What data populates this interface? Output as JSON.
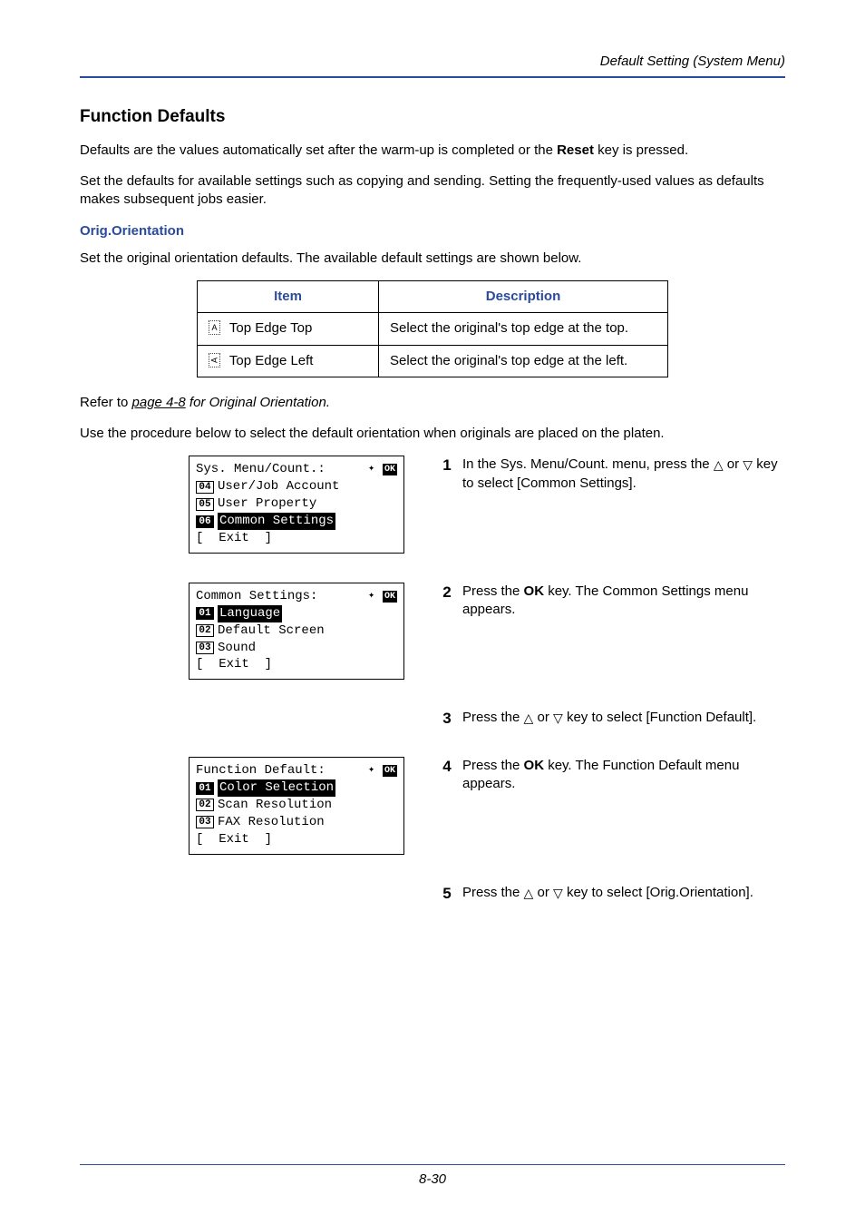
{
  "running_head": "Default Setting (System Menu)",
  "section": {
    "title": "Function Defaults",
    "intro1_a": "Defaults are the values automatically set after the warm-up is completed or the ",
    "intro1_bold": "Reset",
    "intro1_b": " key is pressed.",
    "intro2": "Set the defaults for available settings such as copying and sending. Setting the frequently-used values as defaults makes subsequent jobs easier."
  },
  "orig": {
    "heading": "Orig.Orientation",
    "para": "Set the original orientation defaults. The available default settings are shown below."
  },
  "table": {
    "headers": {
      "item": "Item",
      "desc": "Description"
    },
    "rows": [
      {
        "item": "Top Edge Top",
        "desc": "Select the original's top edge at the top."
      },
      {
        "item": "Top Edge Left",
        "desc": "Select the original's top edge at the left."
      }
    ]
  },
  "refer": {
    "a": "Refer to ",
    "link": "page 4-8",
    "b": " for Original Orientation."
  },
  "procedure_intro": "Use the procedure below to select the default orientation when originals are placed on the platen.",
  "lcd": {
    "screen1": {
      "title_a": "Sys. Menu/Count.",
      "title_b": ":",
      "items": [
        {
          "num": "04",
          "label": "User/Job Account",
          "hl": false
        },
        {
          "num": "05",
          "label": "User Property",
          "hl": false
        },
        {
          "num": "06",
          "label": "Common Settings",
          "hl": true
        }
      ],
      "exit": "[  Exit  ]"
    },
    "screen2": {
      "title_a": "Common Settings",
      "title_b": ":",
      "items": [
        {
          "num": "01",
          "label": "Language",
          "hl": true
        },
        {
          "num": "02",
          "label": "Default Screen",
          "hl": false
        },
        {
          "num": "03",
          "label": "Sound",
          "hl": false
        }
      ],
      "exit": "[  Exit  ]"
    },
    "screen3": {
      "title_a": "Function Default",
      "title_b": ":",
      "items": [
        {
          "num": "01",
          "label": "Color Selection",
          "hl": true
        },
        {
          "num": "02",
          "label": "Scan Resolution",
          "hl": false
        },
        {
          "num": "03",
          "label": "FAX Resolution",
          "hl": false
        }
      ],
      "exit": "[  Exit  ]"
    }
  },
  "steps": {
    "s1": {
      "num": "1",
      "a": "In the Sys. Menu/Count. menu, press the ",
      "b": " or ",
      "c": " key to select [Common Settings]."
    },
    "s2": {
      "num": "2",
      "a": "Press the ",
      "ok": "OK",
      "b": " key. The Common Settings menu appears."
    },
    "s3": {
      "num": "3",
      "a": "Press the ",
      "b": " or ",
      "c": " key to select [Function Default]."
    },
    "s4": {
      "num": "4",
      "a": "Press the ",
      "ok": "OK",
      "b": " key. The Function Default menu appears."
    },
    "s5": {
      "num": "5",
      "a": "Press the ",
      "b": " or ",
      "c": " key to select [Orig.Orientation]."
    }
  },
  "footer": "8-30"
}
